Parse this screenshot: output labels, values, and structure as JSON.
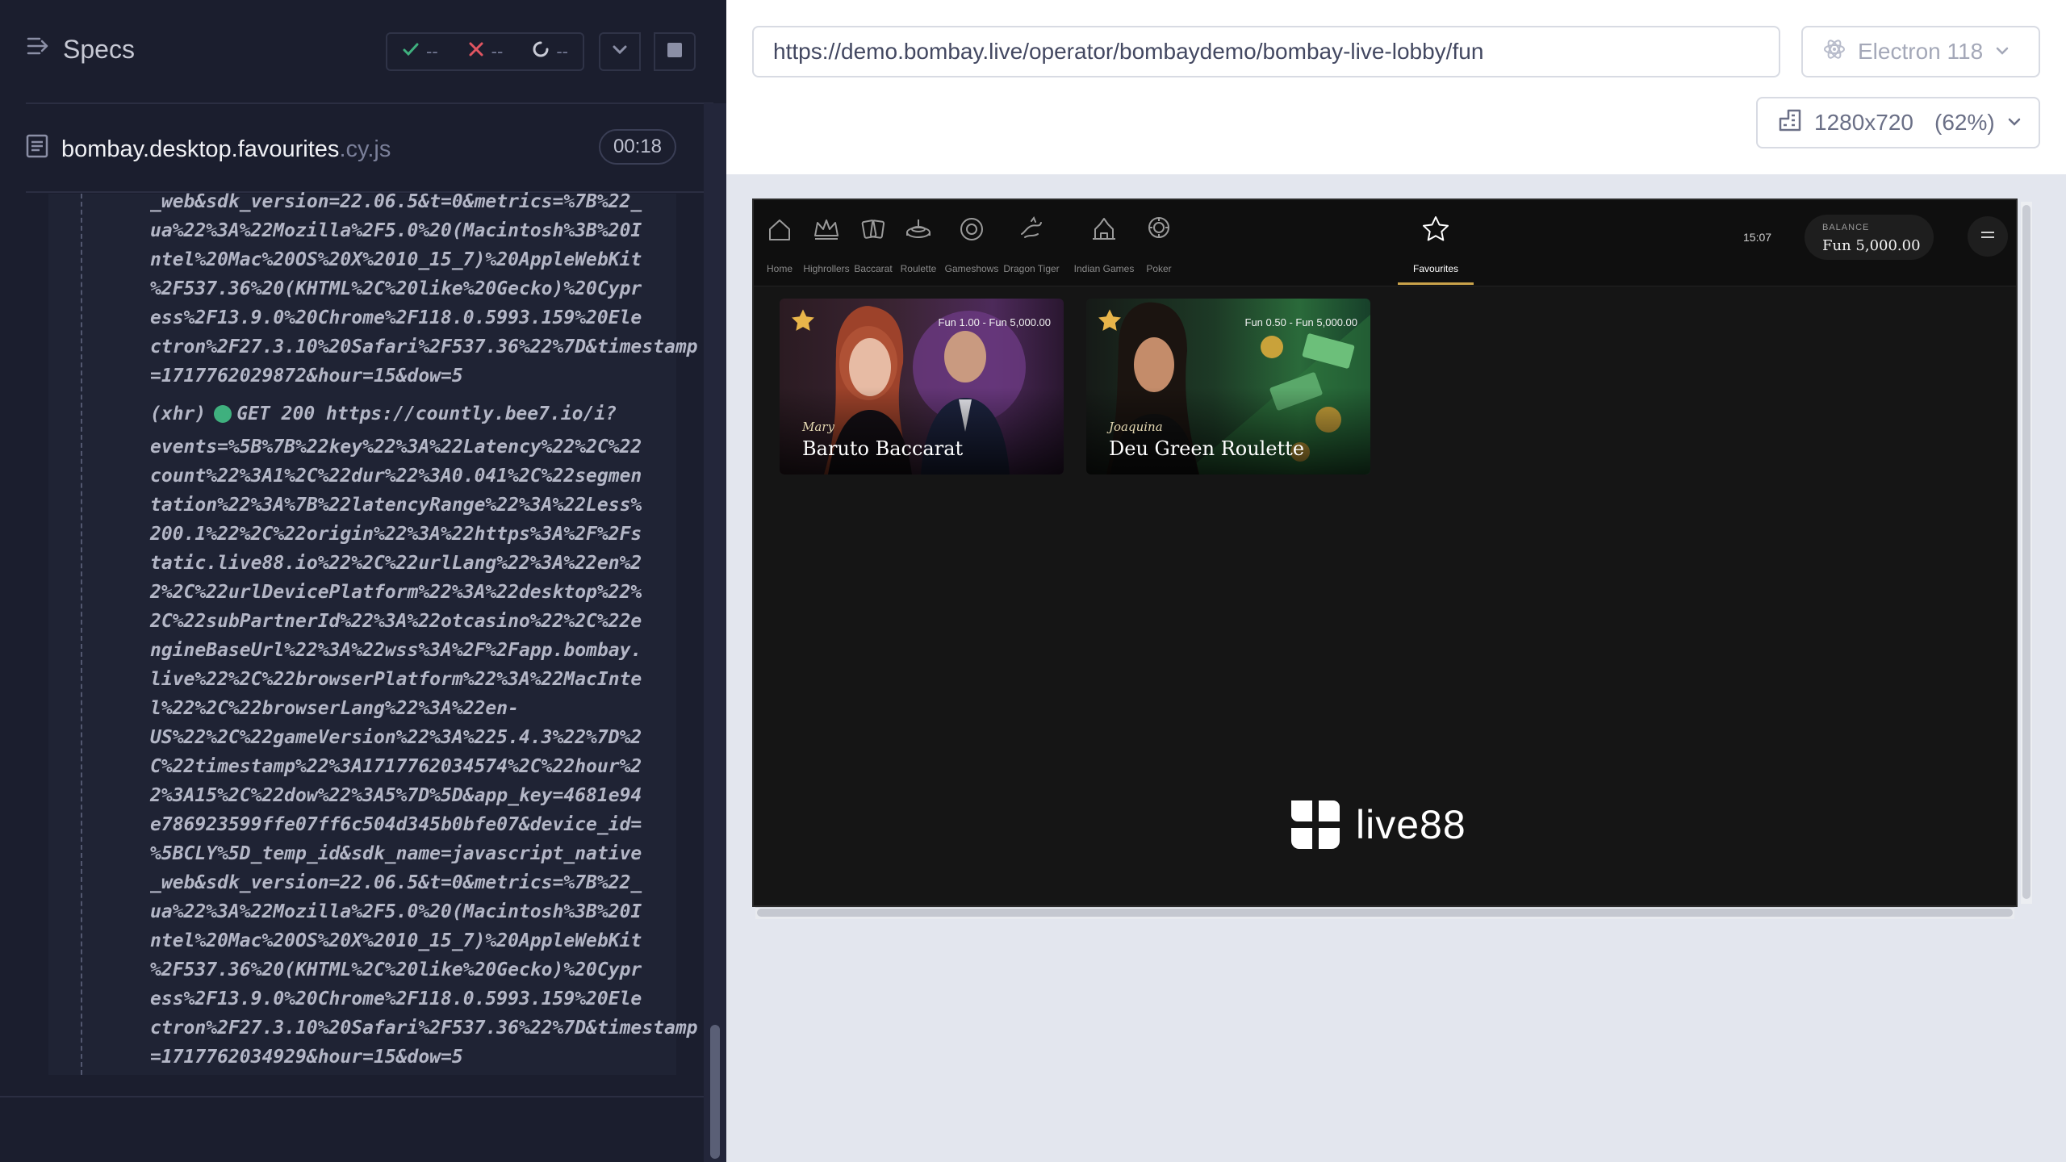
{
  "runner": {
    "title": "Specs",
    "stats": {
      "passed": "--",
      "failed": "--",
      "pending": "--"
    },
    "spec_file": "bombay.desktop.favourites",
    "spec_ext": ".cy.js",
    "timer": "00:18",
    "log_top_lines": [
      "_web&sdk_version=22.06.5&t=0&metrics=%7B%22_",
      "ua%22%3A%22Mozilla%2F5.0%20(Macintosh%3B%20I",
      "ntel%20Mac%20OS%20X%2010_15_7)%20AppleWebKit",
      "%2F537.36%20(KHTML%2C%20like%20Gecko)%20Cypr",
      "ess%2F13.9.0%20Chrome%2F118.0.5993.159%20Ele",
      "ctron%2F27.3.10%20Safari%2F537.36%22%7D&timestamp",
      "=1717762029872&hour=15&dow=5"
    ],
    "xhr_tag": "(xhr)",
    "xhr_request": "GET 200 https://countly.bee7.io/i?",
    "log_bottom_lines": [
      "events=%5B%7B%22key%22%3A%22Latency%22%2C%22",
      "count%22%3A1%2C%22dur%22%3A0.041%2C%22segmen",
      "tation%22%3A%7B%22latencyRange%22%3A%22Less%",
      "200.1%22%2C%22origin%22%3A%22https%3A%2F%2Fs",
      "tatic.live88.io%22%2C%22urlLang%22%3A%22en%2",
      "2%2C%22urlDevicePlatform%22%3A%22desktop%22%",
      "2C%22subPartnerId%22%3A%22otcasino%22%2C%22e",
      "ngineBaseUrl%22%3A%22wss%3A%2F%2Fapp.bombay.",
      "live%22%2C%22browserPlatform%22%3A%22MacInte",
      "l%22%2C%22browserLang%22%3A%22en-",
      "US%22%2C%22gameVersion%22%3A%225.4.3%22%7D%2",
      "C%22timestamp%22%3A1717762034574%2C%22hour%2",
      "2%3A15%2C%22dow%22%3A5%7D%5D&app_key=4681e94",
      "e786923599ffe07ff6c504d345b0bfe07&device_id=",
      "%5BCLY%5D_temp_id&sdk_name=javascript_native",
      "_web&sdk_version=22.06.5&t=0&metrics=%7B%22_",
      "ua%22%3A%22Mozilla%2F5.0%20(Macintosh%3B%20I",
      "ntel%20Mac%20OS%20X%2010_15_7)%20AppleWebKit",
      "%2F537.36%20(KHTML%2C%20like%20Gecko)%20Cypr",
      "ess%2F13.9.0%20Chrome%2F118.0.5993.159%20Ele",
      "ctron%2F27.3.10%20Safari%2F537.36%22%7D&timestamp",
      "=1717762034929&hour=15&dow=5"
    ]
  },
  "browser": {
    "url": "https://demo.bombay.live/operator/bombaydemo/bombay-live-lobby/fun",
    "name": "Electron 118",
    "viewport": "1280x720",
    "zoom": "(62%)"
  },
  "app": {
    "nav": [
      {
        "label": "Home",
        "icon": "home-icon"
      },
      {
        "label": "Highrollers",
        "icon": "crown-icon"
      },
      {
        "label": "Baccarat",
        "icon": "cards-icon"
      },
      {
        "label": "Roulette",
        "icon": "roulette-icon"
      },
      {
        "label": "Gameshows",
        "icon": "wheel-icon"
      },
      {
        "label": "Dragon Tiger",
        "icon": "dragon-icon"
      },
      {
        "label": "Indian Games",
        "icon": "temple-icon"
      },
      {
        "label": "Poker",
        "icon": "chip-icon"
      },
      {
        "label": "Favourites",
        "icon": "star-icon"
      }
    ],
    "active_tab": "Favourites",
    "time": "15:07",
    "balance_label": "BALANCE",
    "balance_value": "Fun 5,000.00",
    "games": [
      {
        "dealer": "Mary",
        "name": "Baruto Baccarat",
        "limits": "Fun 1.00 - Fun 5,000.00"
      },
      {
        "dealer": "Joaquina",
        "name": "Deu Green Roulette",
        "limits": "Fun 0.50 - Fun 5,000.00"
      }
    ],
    "brand": "live88"
  },
  "colors": {
    "runner_bg": "#1b1e2e",
    "passed": "#3fb07e",
    "failed": "#e05561",
    "favourite_star": "#e8b54a",
    "active_underline": "#c9a24a"
  }
}
